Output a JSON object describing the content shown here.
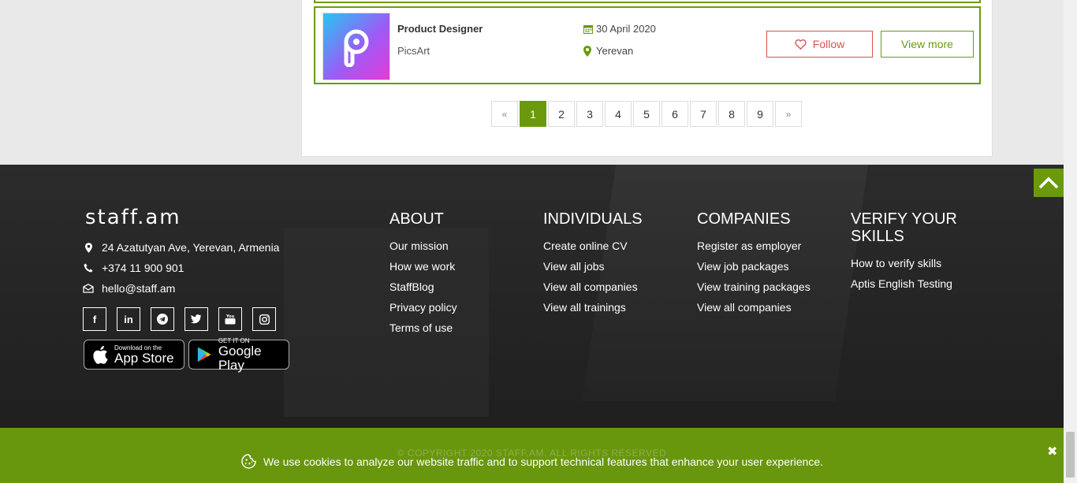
{
  "job": {
    "title": "Product Designer",
    "company": "PicsArt",
    "date": "30 April 2020",
    "location": "Yerevan",
    "follow_label": "Follow",
    "view_label": "View more"
  },
  "pagination": {
    "prev": "«",
    "next": "»",
    "pages": [
      "1",
      "2",
      "3",
      "4",
      "5",
      "6",
      "7",
      "8",
      "9"
    ],
    "current": "1"
  },
  "footer": {
    "brand": "staff.am",
    "address": "24 Azatutyan Ave, Yerevan, Armenia",
    "phone": "+374 11 900 901",
    "email": "hello@staff.am",
    "social": [
      "facebook",
      "linkedin",
      "telegram",
      "twitter",
      "youtube",
      "instagram"
    ],
    "app_store": {
      "small": "Download on the",
      "big": "App Store"
    },
    "google_play": {
      "small": "GET IT ON",
      "big": "Google Play"
    },
    "columns": [
      {
        "title": "ABOUT",
        "links": [
          "Our mission",
          "How we work",
          "StaffBlog",
          "Privacy policy",
          "Terms of use"
        ]
      },
      {
        "title": "INDIVIDUALS",
        "links": [
          "Create online CV",
          "View all jobs",
          "View all companies",
          "View all trainings"
        ]
      },
      {
        "title": "COMPANIES",
        "links": [
          "Register as employer",
          "View job packages",
          "View training packages",
          "View all companies"
        ]
      },
      {
        "title": "VERIFY YOUR SKILLS",
        "links": [
          "How to verify skills",
          "Aptis English Testing"
        ]
      }
    ],
    "copyright": "© COPYRIGHT 2020 STAFF.AM. ALL RIGHTS RESERVED"
  },
  "cookie": {
    "text": "We use cookies to analyze our website traffic and to support technical features that enhance your user experience.",
    "close": "✖"
  },
  "colors": {
    "accent": "#6a9a0c",
    "follow": "#d9534f"
  }
}
